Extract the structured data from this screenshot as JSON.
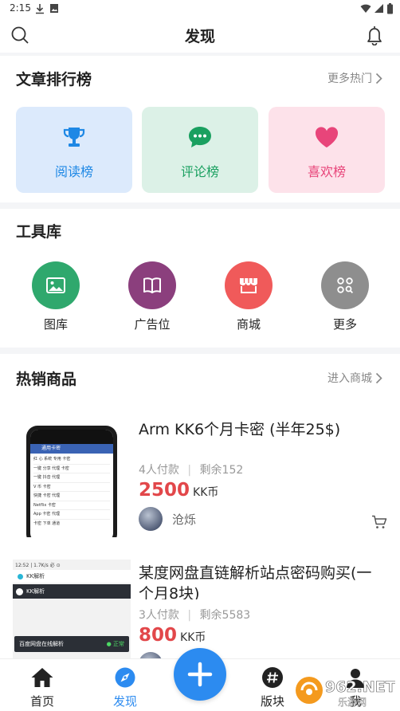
{
  "status_bar": {
    "time": "2:15"
  },
  "header": {
    "title": "发现"
  },
  "rankings": {
    "title": "文章排行榜",
    "more": "更多热门",
    "items": [
      {
        "label": "阅读榜",
        "icon": "trophy-icon",
        "bg": "#dceafc",
        "color": "#1e88e5"
      },
      {
        "label": "评论榜",
        "icon": "chat-bubble-icon",
        "bg": "#dcf1e7",
        "color": "#1aa060"
      },
      {
        "label": "喜欢榜",
        "icon": "heart-icon",
        "bg": "#fde2ea",
        "color": "#e8457a"
      }
    ]
  },
  "tools": {
    "title": "工具库",
    "items": [
      {
        "label": "图库",
        "icon": "image-icon",
        "color": "#2fa86d"
      },
      {
        "label": "广告位",
        "icon": "book-icon",
        "color": "#8b3f7d"
      },
      {
        "label": "商城",
        "icon": "store-icon",
        "color": "#f05a5a"
      },
      {
        "label": "更多",
        "icon": "grid-icon",
        "color": "#8e8e8e"
      }
    ]
  },
  "hot_products": {
    "title": "热销商品",
    "more": "进入商城",
    "items": [
      {
        "title": "Arm KK6个月卡密 (半年25$)",
        "paid": "4人付款",
        "remaining": "剩余152",
        "price": "2500",
        "unit": "KK币",
        "seller": "沧烁",
        "thumb_header": "通用卡密",
        "thumb_rows": [
          "红 心 系统 专用 卡密",
          "一键 分享 代理 卡密",
          "一键 抖音 代理",
          "V 币 卡密",
          "快捷 卡密 代理",
          "Netflix 卡密",
          "App 卡密 代理",
          "卡密 下单 通道"
        ]
      },
      {
        "title": "某度网盘直链解析站点密码购买(一个月8块)",
        "paid": "3人付款",
        "remaining": "剩余5583",
        "price": "800",
        "unit": "KK币",
        "thumb_status": "12:52 | 1.7K/s 必 ⊙",
        "thumb_app": "KK解析",
        "thumb_banner": "KK解析",
        "thumb_footer": "百度网盘在线解析",
        "thumb_badge": "● 正常"
      }
    ]
  },
  "tabbar": {
    "items": [
      {
        "label": "首页",
        "icon": "home-icon"
      },
      {
        "label": "发现",
        "icon": "compass-icon",
        "active": true
      },
      {
        "label": "版块",
        "icon": "hashtag-icon"
      },
      {
        "label": "我",
        "icon": "user-icon"
      }
    ],
    "fab_icon": "plus-icon",
    "active_color": "#2c8bf0"
  },
  "watermark": {
    "text": "962.NET",
    "sub": "乐游网"
  }
}
